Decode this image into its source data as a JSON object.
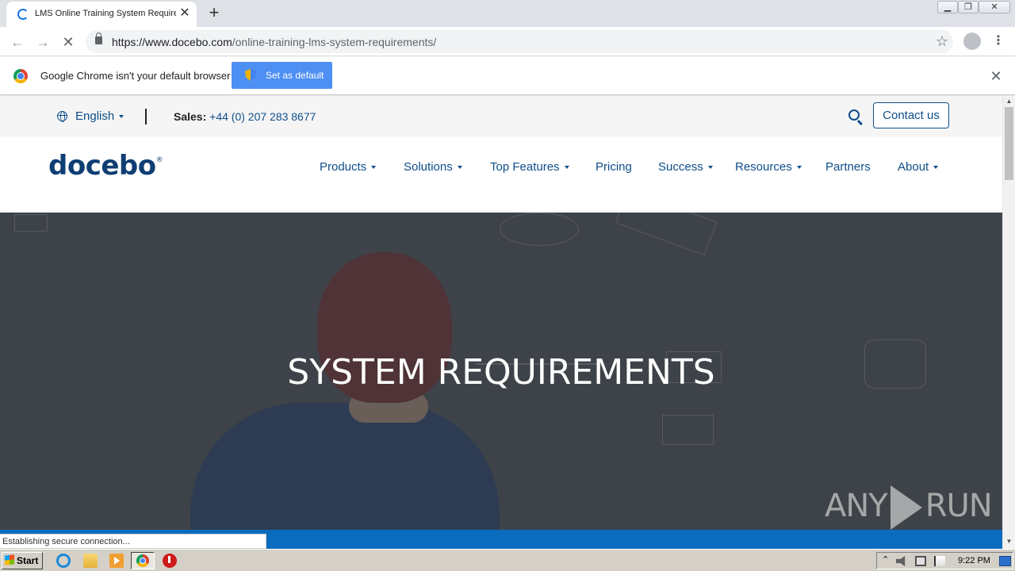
{
  "browser": {
    "tab_title": "LMS Online Training System Requirements",
    "url_host": "https://www.docebo.com",
    "url_path": "/online-training-lms-system-requirements/",
    "infobar_message": "Google Chrome isn't your default browser",
    "set_default_label": "Set as default",
    "status_text": "Establishing secure connection..."
  },
  "site": {
    "language": "English",
    "sales_label": "Sales:",
    "sales_phone": "+44 (0) 207 283 8677",
    "contact_label": "Contact us",
    "logo_text": "docebo",
    "nav": [
      {
        "label": "Products"
      },
      {
        "label": "Solutions"
      },
      {
        "label": "Top Features"
      },
      {
        "label": "Pricing"
      },
      {
        "label": "Success"
      },
      {
        "label": "Resources"
      },
      {
        "label": "Partners"
      },
      {
        "label": "About"
      }
    ],
    "hero_title": "SYSTEM REQUIREMENTS"
  },
  "watermark": {
    "left": "ANY",
    "right": "RUN"
  },
  "taskbar": {
    "start_label": "Start",
    "clock": "9:22 PM"
  },
  "colors": {
    "brand": "#0e4e8a",
    "accent_blue": "#0a6cbe",
    "chrome_button": "#4e8ff3"
  }
}
